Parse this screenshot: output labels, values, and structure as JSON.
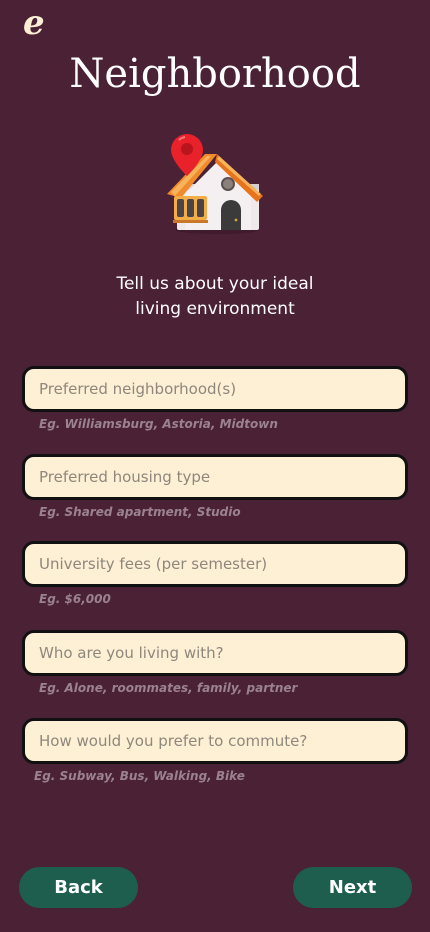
{
  "app": {
    "logo_text": "e",
    "title": "Neighborhood",
    "subtitle_line1": "Tell us about your ideal",
    "subtitle_line2": "living environment"
  },
  "form": {
    "fields": [
      {
        "placeholder": "Preferred neighborhood(s)",
        "hint": "Eg. Williamsburg, Astoria, Midtown"
      },
      {
        "placeholder": "Preferred housing type",
        "hint": "Eg. Shared apartment, Studio"
      },
      {
        "placeholder": "University fees (per semester)",
        "hint": "Eg. $6,000"
      },
      {
        "placeholder": "Who are you living with?",
        "hint": "Eg. Alone, roommates, family, partner"
      },
      {
        "placeholder": "How would you prefer to commute?",
        "hint": "Eg. Subway, Bus, Walking, Bike"
      }
    ]
  },
  "nav": {
    "back_label": "Back",
    "next_label": "Next"
  },
  "colors": {
    "background": "#4a2135",
    "field_fill": "#fdf0d5",
    "button": "#1e5e4f"
  },
  "icons": {
    "hero": "house-with-location-pin-icon"
  }
}
